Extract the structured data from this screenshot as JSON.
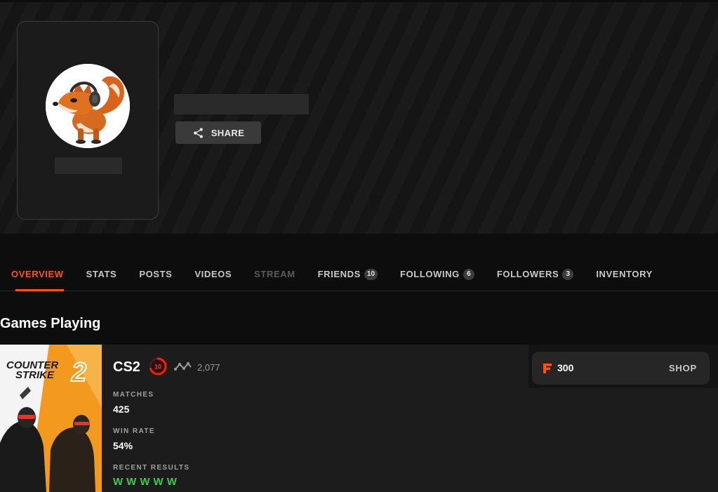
{
  "profile": {
    "share_label": "SHARE"
  },
  "tabs": [
    {
      "label": "OVERVIEW",
      "badge": null,
      "state": "active"
    },
    {
      "label": "STATS",
      "badge": null,
      "state": "normal"
    },
    {
      "label": "POSTS",
      "badge": null,
      "state": "normal"
    },
    {
      "label": "VIDEOS",
      "badge": null,
      "state": "normal"
    },
    {
      "label": "STREAM",
      "badge": null,
      "state": "disabled"
    },
    {
      "label": "FRIENDS",
      "badge": "10",
      "state": "normal"
    },
    {
      "label": "FOLLOWING",
      "badge": "6",
      "state": "normal"
    },
    {
      "label": "FOLLOWERS",
      "badge": "3",
      "state": "normal"
    },
    {
      "label": "INVENTORY",
      "badge": null,
      "state": "normal"
    }
  ],
  "section": {
    "title": "Games Playing"
  },
  "game": {
    "cover_line1": "COUNTER",
    "cover_line2": "STRIKE",
    "cover_number": "2",
    "name": "CS2",
    "level": "10",
    "elo": "2,077",
    "matches_label": "MATCHES",
    "matches_value": "425",
    "winrate_label": "WIN RATE",
    "winrate_value": "54%",
    "recent_label": "RECENT RESULTS",
    "recent_results": [
      "W",
      "W",
      "W",
      "W",
      "W"
    ]
  },
  "shop": {
    "points": "300",
    "shop_label": "SHOP"
  },
  "colors": {
    "accent": "#ff5500",
    "win": "#3ccc4a",
    "background": "#0d0d0d",
    "card": "#1c1c1c"
  },
  "icons": {
    "share": "share-icon",
    "level": "faceit-level-10-icon",
    "elo": "elo-trend-icon",
    "points": "faceit-points-icon"
  }
}
